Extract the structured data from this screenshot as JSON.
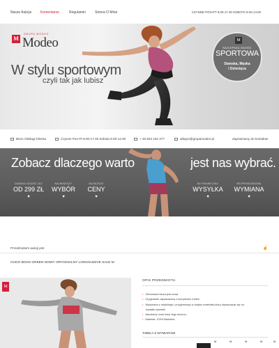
{
  "nav": {
    "items": [
      "Nasze Aukcje",
      "Komentarze",
      "Regulamin",
      "Strona O Mnie"
    ],
    "active_index": 1,
    "hours": "CZYNNE  PON-PT 8.00-17.30  SOBOTA 9.00-14.00"
  },
  "hero": {
    "logo_letter": "M",
    "logo_group": "GRUPA MODEO",
    "logo_name": "Modeo",
    "title": "W stylu sportowym",
    "subtitle": "czyli tak jak lubisz",
    "badge": {
      "logo_letter": "M",
      "line1": "NAJLEPSZA ODZIEŻ",
      "line2": "SPORTOWA",
      "line3": "Damska, Męska",
      "line4": "i Dziecięca"
    }
  },
  "infobar": {
    "service": "Biuro Obsługi Klienta",
    "hours": "Czynne  Pon-Pt 9.00-17.30  Sobota 9.00-14.00",
    "phone": "+ 48 502 232 477",
    "email": "allegro@grupamodeo.pl",
    "contact": "Zapraszamy do kontaktu!"
  },
  "promo": {
    "title_left": "Zobacz dlaczego warto",
    "title_right": "jest nas wybrać.",
    "features": [
      {
        "small": "DAMSKA ODZIEŻ JUŻ",
        "big": "OD 299 ZŁ"
      },
      {
        "small": "NAJWIĘKSZY",
        "big": "WYBÓR"
      },
      {
        "small": "NAJNIŻSZE",
        "big": "CENY"
      },
      {
        "small": "BŁYSKAWICZNA",
        "big": "WYSYŁKA"
      },
      {
        "small": "BEZPROBLEMOWA",
        "big": "WYMIANA"
      }
    ],
    "heart": "♥"
  },
  "breadcrumb": "Przedmiotem aukcji jest",
  "product": {
    "title": "HUGO BOSS GREEN NOWY ORYGINALNY LONGSLEEVE SALE M",
    "logo_letter": "M",
    "description_heading": "OPIS PRZEDMIOTU",
    "bullet": "•",
    "bullets": [
      "Oferowana bluza jest nowa",
      "Oryginalnie zapakowana z kompletem metek",
      "Wykonana z miękkiego i przyjemnego w dotyku materiału,który dopasowuje się do",
      "kształtu sylwetki",
      "Absolutny must have tego sezonu.",
      "Materiał: 100% Bawełna"
    ],
    "size_heading": "TABELA Z WYMIARAMI",
    "size_headers": [
      "M",
      "M",
      "M",
      "M",
      "M"
    ]
  },
  "colors": {
    "accent": "#d3203a",
    "promo_bg": "#5c5c5c",
    "badge_bg": "#6e6e6e"
  }
}
